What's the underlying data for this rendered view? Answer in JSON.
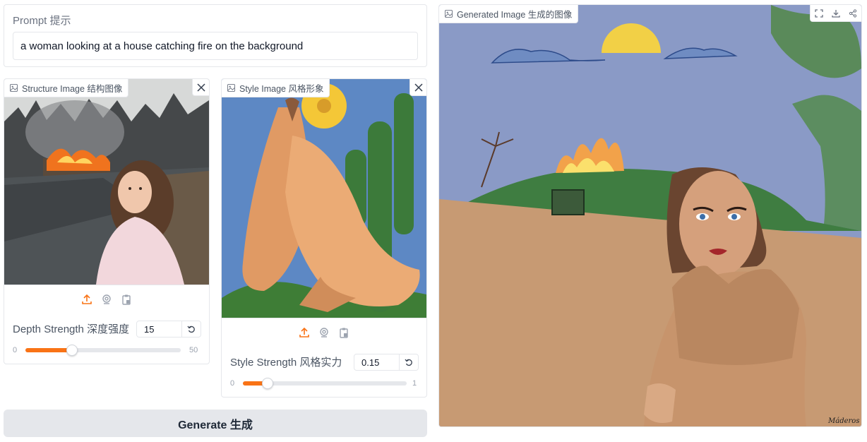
{
  "prompt": {
    "label": "Prompt  提示",
    "value": "a woman looking at a house catching fire on the background"
  },
  "structure_image": {
    "label": "Structure Image  结构图像",
    "slider": {
      "label": "Depth Strength  深度强度",
      "value": "15",
      "min": "0",
      "max": "50",
      "fraction": 0.3
    }
  },
  "style_image": {
    "label": "Style Image  风格形象",
    "slider": {
      "label": "Style Strength  风格实力",
      "value": "0.15",
      "min": "0",
      "max": "1",
      "fraction": 0.15
    }
  },
  "generate": {
    "label": "Generate  生成"
  },
  "output": {
    "label": "Generated Image  生成的图像",
    "signature": "Máderos"
  },
  "icons": [
    "image-icon",
    "close-icon",
    "upload-icon",
    "webcam-icon",
    "clipboard-icon",
    "fullscreen-icon",
    "download-icon",
    "share-icon",
    "reset-icon"
  ],
  "colors": {
    "accent": "#f97316",
    "border": "#e5e7eb",
    "button_bg": "#e5e7eb"
  }
}
